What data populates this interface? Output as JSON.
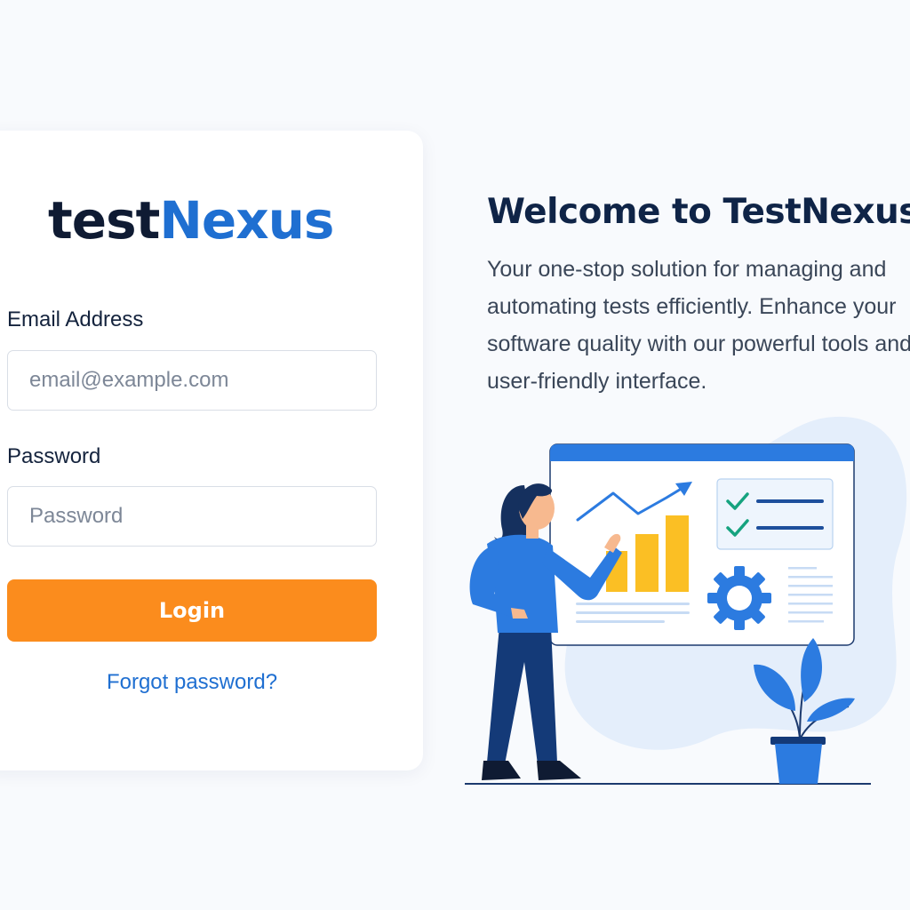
{
  "brand": {
    "part1": "test",
    "part2": "Nexus"
  },
  "login": {
    "email_label": "Email Address",
    "email_placeholder": "email@example.com",
    "email_value": "",
    "password_label": "Password",
    "password_placeholder": "Password",
    "password_value": "",
    "login_button": "Login",
    "forgot_link": "Forgot password?"
  },
  "welcome": {
    "title": "Welcome to TestNexus",
    "lines": [
      "Your one-stop solution for managing and",
      "automating tests efficiently. Enhance your",
      "software quality with our powerful tools and",
      "user-friendly interface."
    ]
  },
  "colors": {
    "brand_dark": "#0f1b33",
    "brand_blue": "#1f6fd1",
    "accent_orange": "#fb8c1d",
    "background": "#f8fafd"
  },
  "illustration": {
    "icons": [
      "chart-icon",
      "trend-arrow-icon",
      "checkmark-icon",
      "gear-icon",
      "person-figure",
      "potted-plant"
    ]
  }
}
